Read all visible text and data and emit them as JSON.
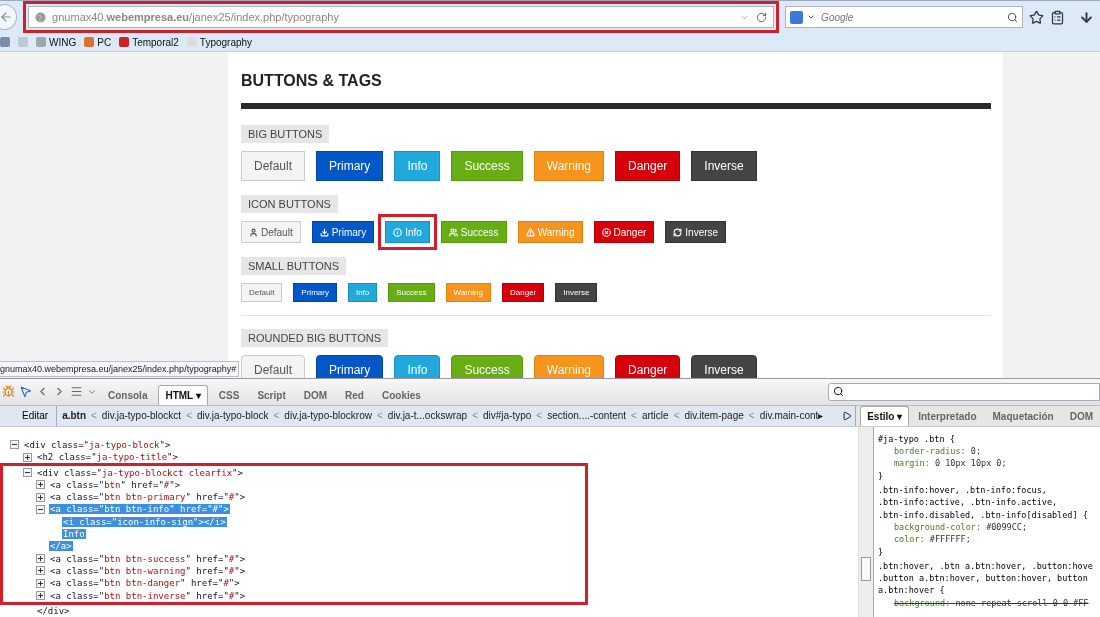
{
  "browser": {
    "url": "gnumax40.**webempresa.eu**/janex25/index.php/typography",
    "url_highlighted": true,
    "search_placeholder": "Google",
    "bookmarks": [
      {
        "label": "WING"
      },
      {
        "label": "PC"
      },
      {
        "label": "Temporal2"
      },
      {
        "label": "Typography"
      }
    ]
  },
  "page": {
    "title": "BUTTONS & TAGS",
    "sections": [
      {
        "title": "BIG BUTTONS",
        "kind": "big",
        "buttons": [
          {
            "label": "Default"
          },
          {
            "label": "Primary"
          },
          {
            "label": "Info"
          },
          {
            "label": "Success"
          },
          {
            "label": "Warning"
          },
          {
            "label": "Danger"
          },
          {
            "label": "Inverse"
          }
        ]
      },
      {
        "title": "ICON BUTTONS",
        "kind": "icon",
        "buttons": [
          {
            "label": "Default"
          },
          {
            "label": "Primary"
          },
          {
            "label": "Info",
            "highlighted": true
          },
          {
            "label": "Success"
          },
          {
            "label": "Warning"
          },
          {
            "label": "Danger"
          },
          {
            "label": "Inverse"
          }
        ]
      },
      {
        "title": "SMALL BUTTONS",
        "kind": "small",
        "buttons": [
          {
            "label": "Default"
          },
          {
            "label": "Primary"
          },
          {
            "label": "Info"
          },
          {
            "label": "Success"
          },
          {
            "label": "Warning"
          },
          {
            "label": "Danger"
          },
          {
            "label": "Inverse"
          }
        ]
      },
      {
        "title": "ROUNDED BIG BUTTONS",
        "kind": "rounded",
        "buttons": [
          {
            "label": "Default"
          },
          {
            "label": "Primary"
          },
          {
            "label": "Info"
          },
          {
            "label": "Success"
          },
          {
            "label": "Warning"
          },
          {
            "label": "Danger"
          },
          {
            "label": "Inverse"
          }
        ]
      }
    ],
    "status_url": "gnumax40.webempresa.eu/janex25/index.php/typography#"
  },
  "devtools": {
    "tabs": [
      {
        "label": "Consola",
        "selected": false
      },
      {
        "label": "HTML ▾",
        "selected": true
      },
      {
        "label": "CSS",
        "selected": false
      },
      {
        "label": "Script",
        "selected": false
      },
      {
        "label": "DOM",
        "selected": false
      },
      {
        "label": "Red",
        "selected": false
      },
      {
        "label": "Cookies",
        "selected": false
      }
    ],
    "edit_button": "Editar",
    "breadcrumb_separator": "<",
    "breadcrumbs": [
      {
        "label": "a.btn",
        "selected": true
      },
      {
        "label": "div.ja-typo-blockct",
        "selected": false
      },
      {
        "label": "div.ja-typo-block",
        "selected": false
      },
      {
        "label": "div.ja-typo-blockrow",
        "selected": false
      },
      {
        "label": "div.ja-t...ockswrap",
        "selected": false
      },
      {
        "label": "div#ja-typo",
        "selected": false
      },
      {
        "label": "section....-content",
        "selected": false
      },
      {
        "label": "article",
        "selected": false
      },
      {
        "label": "div.item-page",
        "selected": false
      },
      {
        "label": "div.main-cont▸",
        "selected": false
      }
    ],
    "side_tabs": [
      {
        "label": "Estilo ▾",
        "selected": true
      },
      {
        "label": "Interpretado",
        "selected": false
      },
      {
        "label": "Maquetación",
        "selected": false
      },
      {
        "label": "DOM",
        "selected": false
      }
    ],
    "tree": [
      {
        "text": "<div class=\"ja-typo-block\">",
        "expanded": true,
        "children": [
          {
            "text": "<h2 class=\"ja-typo-title\">",
            "expanded": false
          },
          {
            "text": "<div class=\"ja-typo-blockct clearfix\">",
            "expanded": true,
            "highlighted": true,
            "close": "</div>",
            "children": [
              {
                "text": "<a class=\"btn\" href=\"#\">",
                "expanded": false
              },
              {
                "text": "<a class=\"btn btn-primary\" href=\"#\">",
                "expanded": false
              },
              {
                "text": "<a class=\"btn btn-info\" href=\"#\">",
                "expanded": true,
                "selected": true,
                "close": "</a>",
                "children": [
                  {
                    "text": "<i class=\"icon-info-sign\"></i>"
                  },
                  {
                    "text": "Info"
                  }
                ]
              },
              {
                "text": "<a class=\"btn btn-success\" href=\"#\">",
                "expanded": false
              },
              {
                "text": "<a class=\"btn btn-warning\" href=\"#\">",
                "expanded": false
              },
              {
                "text": "<a class=\"btn btn-danger\" href=\"#\">",
                "expanded": false
              },
              {
                "text": "<a class=\"btn btn-inverse\" href=\"#\">",
                "expanded": false
              }
            ]
          }
        ]
      }
    ],
    "css_rules": [
      {
        "selector": [
          "#ja-typo .btn {"
        ],
        "declarations": [
          {
            "property": "border-radius:",
            "value": "0;",
            "overridden": false
          },
          {
            "property": "margin:",
            "value": "0 10px 10px 0;",
            "overridden": false
          }
        ],
        "close": "}"
      },
      {
        "selector": [
          ".btn-info:hover, .btn-info:focus,",
          ".btn-info:active, .btn-info.active,",
          ".btn-info.disabled, .btn-info[disabled] {"
        ],
        "declarations": [
          {
            "property": "background-color:",
            "value": "#0099CC;",
            "overridden": false
          },
          {
            "property": "color:",
            "value": "#FFFFFF;",
            "overridden": false
          }
        ],
        "close": "}"
      },
      {
        "selector": [
          ".btn:hover, .btn a.btn:hover, .button:hove",
          ".button a.btn:hover, button:hover, button",
          "a.btn:hover {"
        ],
        "declarations": [
          {
            "property": "background:",
            "value": "none repeat scroll 0 0 #FF",
            "overridden": true
          }
        ]
      }
    ]
  }
}
